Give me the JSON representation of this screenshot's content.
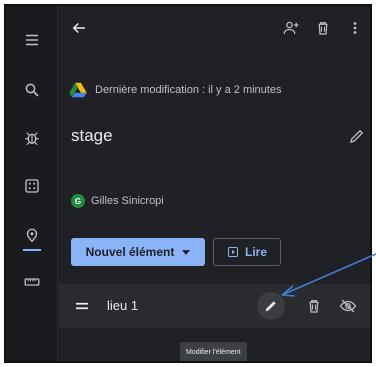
{
  "header": {
    "last_modified": "Dernière modification : il y a 2 minutes"
  },
  "form": {
    "title": "stage",
    "owner_initial": "G",
    "owner_name": "Gilles Sinicropi"
  },
  "actions": {
    "new_element": "Nouvel élément",
    "read": "Lire"
  },
  "item": {
    "label": "lieu 1"
  },
  "tooltip": {
    "edit": "Modifier l'élément"
  },
  "colors": {
    "accent": "#8ab4f8",
    "background": "#202124",
    "rail": "#1a1b1e",
    "row": "#2a2b2e",
    "annotation_arrow": "#3d7dd6"
  },
  "icons": {
    "rail": [
      "menu-icon",
      "search-icon",
      "bug-icon",
      "dice-icon",
      "location-icon",
      "keyboard-icon"
    ],
    "topbar": [
      "back-arrow-icon",
      "add-person-icon",
      "trash-icon",
      "more-vert-icon"
    ]
  }
}
